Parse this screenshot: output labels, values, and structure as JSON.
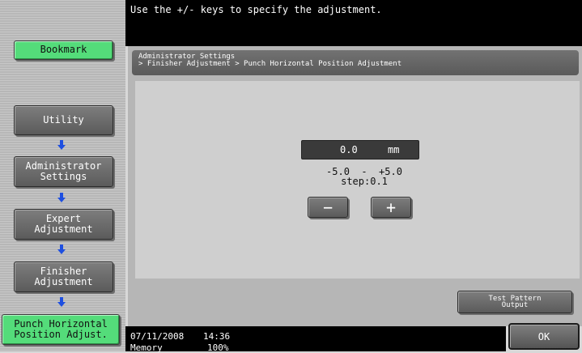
{
  "top_message": "Use the +/- keys to specify the adjustment.",
  "sidebar": {
    "bookmark_label": "Bookmark",
    "nav": [
      {
        "label": "Utility"
      },
      {
        "label": "Administrator\nSettings"
      },
      {
        "label": "Expert\nAdjustment"
      },
      {
        "label": "Finisher\nAdjustment"
      },
      {
        "label": "Punch Horizontal\nPosition Adjust."
      }
    ]
  },
  "panel": {
    "breadcrumb_line1": "Administrator Settings",
    "breadcrumb_line2": "> Finisher Adjustment > Punch Horizontal Position Adjustment"
  },
  "adjust": {
    "value": "0.0",
    "unit": "mm",
    "range": "-5.0  -  +5.0",
    "step": "step:0.1",
    "minus_label": "−",
    "plus_label": "+"
  },
  "buttons": {
    "test_pattern": "Test Pattern\nOutput",
    "ok": "OK"
  },
  "status": {
    "date": "07/11/2008",
    "time": "14:36",
    "memory_label": "Memory",
    "memory_value": "100%"
  },
  "colors": {
    "highlight_green": "#54dc7a",
    "arrow_blue": "#1e4fe0"
  }
}
